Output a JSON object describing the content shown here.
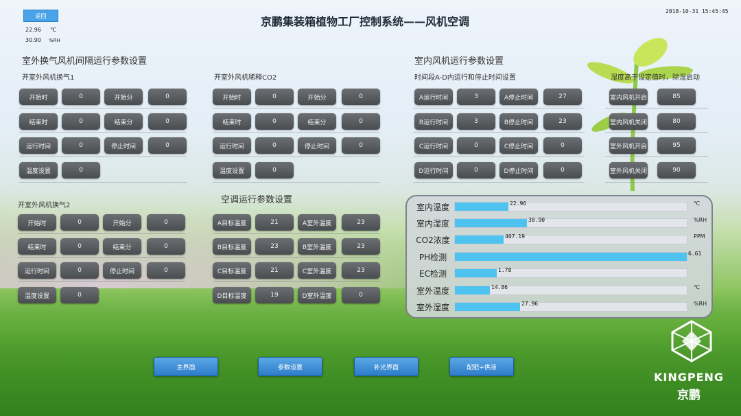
{
  "header": {
    "back_label": "返回",
    "title": "京鹏集装箱植物工厂控制系统——风机空调",
    "datetime": "2018-10-31 15:45:45",
    "temp_value": "22.96",
    "temp_unit": "℃",
    "hum_value": "30.90",
    "hum_unit": "%RH"
  },
  "outdoor": {
    "section_title": "室外换气风机间隔运行参数设置",
    "group1": {
      "title": "开室外风机换气1",
      "start_hour_label": "开始时",
      "start_hour_value": "0",
      "start_min_label": "开始分",
      "start_min_value": "0",
      "end_hour_label": "结束时",
      "end_hour_value": "0",
      "end_min_label": "结束分",
      "end_min_value": "0",
      "run_time_label": "运行时间",
      "run_time_value": "0",
      "stop_time_label": "停止时间",
      "stop_time_value": "0",
      "temp_set_label": "温度设置",
      "temp_set_value": "0"
    },
    "group2": {
      "title": "开室外风机换气2",
      "start_hour_label": "开始时",
      "start_hour_value": "0",
      "start_min_label": "开始分",
      "start_min_value": "0",
      "end_hour_label": "结束时",
      "end_hour_value": "0",
      "end_min_label": "结束分",
      "end_min_value": "0",
      "run_time_label": "运行时间",
      "run_time_value": "0",
      "stop_time_label": "停止时间",
      "stop_time_value": "0",
      "temp_set_label": "温度设置",
      "temp_set_value": "0"
    },
    "group3": {
      "title": "开室外风机稀释CO2",
      "start_hour_label": "开始时",
      "start_hour_value": "0",
      "start_min_label": "开始分",
      "start_min_value": "0",
      "end_hour_label": "结束时",
      "end_hour_value": "0",
      "end_min_label": "结束分",
      "end_min_value": "0",
      "run_time_label": "运行时间",
      "run_time_value": "0",
      "stop_time_label": "停止时间",
      "stop_time_value": "0",
      "temp_set_label": "温度设置",
      "temp_set_value": "0"
    }
  },
  "ac": {
    "section_title": "空调运行参数设置",
    "a_target_label": "A目标温度",
    "a_target_value": "21",
    "a_out_label": "A室外温度",
    "a_out_value": "23",
    "b_target_label": "B目标温度",
    "b_target_value": "23",
    "b_out_label": "B室外温度",
    "b_out_value": "23",
    "c_target_label": "C目标温度",
    "c_target_value": "21",
    "c_out_label": "C室外温度",
    "c_out_value": "23",
    "d_target_label": "D目标温度",
    "d_target_value": "19",
    "d_out_label": "D室外温度",
    "d_out_value": "0"
  },
  "indoor": {
    "section_title": "室内风机运行参数设置",
    "timing_title": "时间段A-D内运行和停止时间设置",
    "a_run_label": "A运行时间",
    "a_run_value": "3",
    "a_stop_label": "A停止时间",
    "a_stop_value": "27",
    "b_run_label": "B运行时间",
    "b_run_value": "3",
    "b_stop_label": "B停止时间",
    "b_stop_value": "23",
    "c_run_label": "C运行时间",
    "c_run_value": "0",
    "c_stop_label": "C停止时间",
    "c_stop_value": "0",
    "d_run_label": "D运行时间",
    "d_run_value": "0",
    "d_stop_label": "D停止时间",
    "d_stop_value": "0",
    "dehum_title": "湿度高于设定值时，除湿启动",
    "in_fan_on_label": "室内风机开启",
    "in_fan_on_value": "85",
    "in_fan_off_label": "室内风机关闭",
    "in_fan_off_value": "80",
    "out_fan_on_label": "室外风机开启",
    "out_fan_on_value": "95",
    "out_fan_off_label": "室外风机关闭",
    "out_fan_off_value": "90"
  },
  "monitor": [
    {
      "label": "室内温度",
      "value": "22.96",
      "unit": "℃",
      "fill": 0.23
    },
    {
      "label": "室内湿度",
      "value": "30.90",
      "unit": "%RH",
      "fill": 0.31
    },
    {
      "label": "CO2浓度",
      "value": "407.19",
      "unit": "PPM",
      "fill": 0.21
    },
    {
      "label": "PH检测",
      "value": "6.61",
      "unit": "",
      "fill": 1.0
    },
    {
      "label": "EC检测",
      "value": "1.78",
      "unit": "",
      "fill": 0.18
    },
    {
      "label": "室外温度",
      "value": "14.86",
      "unit": "℃",
      "fill": 0.15
    },
    {
      "label": "室外湿度",
      "value": "27.96",
      "unit": "%RH",
      "fill": 0.28
    }
  ],
  "nav": {
    "home": "主界面",
    "params": "参数设置",
    "light": "补光界面",
    "dosing": "配肥+供液"
  },
  "brand": {
    "name_en": "KINGPENG",
    "name_cn": "京鹏"
  },
  "colors": {
    "nav_button": "#2d7cc8",
    "bar_fill": "#4ec3f0",
    "param_button": "#55585b"
  }
}
